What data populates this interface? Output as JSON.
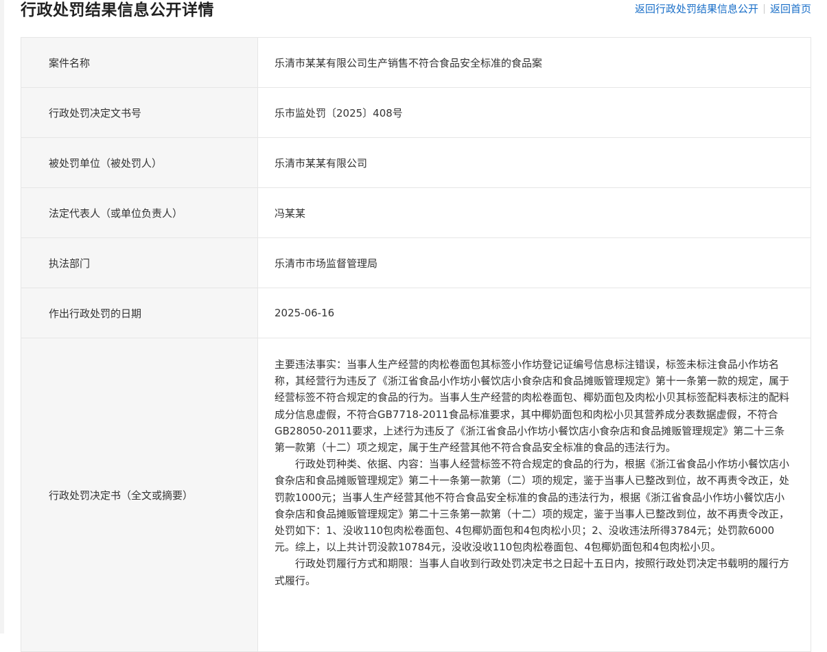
{
  "header": {
    "title": "行政处罚结果信息公开详情",
    "link_back_list": "返回行政处罚结果信息公开",
    "link_home": "返回首页"
  },
  "rows": [
    {
      "label": "案件名称",
      "value": "乐清市某某有限公司生产销售不符合食品安全标准的食品案"
    },
    {
      "label": "行政处罚决定文书号",
      "value": "乐市监处罚〔2025〕408号"
    },
    {
      "label": "被处罚单位（被处罚人）",
      "value": "乐清市某某有限公司"
    },
    {
      "label": "法定代表人（或单位负责人）",
      "value": "冯某某"
    },
    {
      "label": "执法部门",
      "value": "乐清市市场监督管理局"
    },
    {
      "label": "作出行政处罚的日期",
      "value": "2025-06-16"
    }
  ],
  "decision": {
    "label": "行政处罚决定书（全文或摘要）",
    "paragraphs": [
      "主要违法事实：当事人生产经营的肉松卷面包其标签小作坊登记证编号信息标注错误，标签未标注食品小作坊名称，其经营行为违反了《浙江省食品小作坊小餐饮店小食杂店和食品摊贩管理规定》第十一条第一款的规定，属于经营标签不符合规定的食品的行为。当事人生产经营的肉松卷面包、椰奶面包及肉松小贝其标签配料表标注的配料成分信息虚假，不符合GB7718-2011食品标准要求，其中椰奶面包和肉松小贝其营养成分表数据虚假，不符合GB28050-2011要求，上述行为违反了《浙江省食品小作坊小餐饮店小食杂店和食品摊贩管理规定》第二十三条第一款第（十二）项之规定，属于生产经营其他不符合食品安全标准的食品的违法行为。",
      "行政处罚种类、依据、内容：当事人经营标签不符合规定的食品的行为，根据《浙江省食品小作坊小餐饮店小食杂店和食品摊贩管理规定》第二十一条第一款第（二）项的规定，鉴于当事人已整改到位，故不再责令改正，处罚款1000元；当事人生产经营其他不符合食品安全标准的食品的违法行为，根据《浙江省食品小作坊小餐饮店小食杂店和食品摊贩管理规定》第二十三条第一款第（十二）项的规定，鉴于当事人已整改到位，故不再责令改正，处罚如下：1、没收110包肉松卷面包、4包椰奶面包和4包肉松小贝；2、没收违法所得3784元；处罚款6000元。综上，以上共计罚没款10784元，没收没收110包肉松卷面包、4包椰奶面包和4包肉松小贝。",
      "行政处罚履行方式和期限：当事人自收到行政处罚决定书之日起十五日内，按照行政处罚决定书载明的履行方式履行。"
    ]
  }
}
